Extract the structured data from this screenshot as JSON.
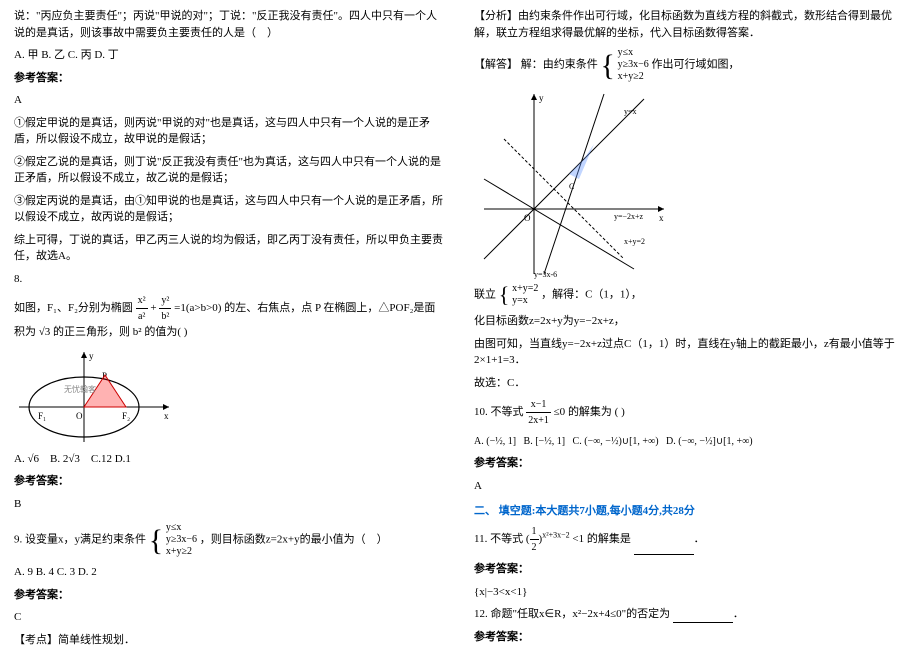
{
  "left": {
    "intro": "说：\"丙应负主要责任\"；丙说\"甲说的对\"；丁说：\"反正我没有责任\"。四人中只有一个人说的是真话，则该事故中需要负主要责任的人是（　）",
    "opts": "A. 甲   B. 乙   C. 丙   D. 丁",
    "ans_label": "参考答案：",
    "ans": "A",
    "p1": "①假定甲说的是真话，则丙说\"甲说的对\"也是真话，这与四人中只有一个人说的是正矛盾，所以假设不成立，故甲说的是假话；",
    "p2": "②假定乙说的是真话，则丁说\"反正我没有责任\"也为真话，这与四人中只有一个人说的是正矛盾，所以假设不成立，故乙说的是假话；",
    "p3": "③假定丙说的是真话，由①知甲说的也是真话，这与四人中只有一个人说的是正矛盾，所以假设不成立，故丙说的是假话；",
    "p4": "综上可得，丁说的真话，甲乙丙三人说的均为假话，即乙丙丁没有责任，所以甲负主要责任，故选A。",
    "q8_num": "8.",
    "q8a": "如图，F₁、F₂分别为椭圆",
    "q8b": "的左、右焦点，点 P 在椭圆上，△POF₂是面积为",
    "q8c": "的正三角形，则 b² 的值为(   )",
    "q8_opts_a": "A.",
    "q8_opts_b": "B.",
    "q8_opts_c": "C.12    D.1",
    "q8_ans": "B",
    "q9_num": "9. ",
    "q9a": "设变量x，y满足约束条件",
    "q9b": "，则目标函数z=2x+y的最小值为（　）",
    "q9_opts": "A. 9    B. 4    C. 3    D. 2",
    "q9_ans": "C",
    "kd_label": "【考点】",
    "kd": "简单线性规划．",
    "sys1": {
      "a": "y≤x",
      "b": "y≥3x−6",
      "c": "x+y≥2"
    },
    "ellipse": {
      "n1": "x²",
      "d1": "a²",
      "n2": "y²",
      "d2": "b²",
      "eq": "=1(a>b>0)"
    },
    "sqrt3": "√3",
    "sqrt6": "√6",
    "two_sqrt3": "2√3",
    "watermark": "无忧翰客"
  },
  "right": {
    "fx_label": "【分析】",
    "fx": "由约束条件作出可行域，化目标函数为直线方程的斜截式，数形结合得到最优解，联立方程组求得最优解的坐标，代入目标函数得答案．",
    "jd_label": "【解答】",
    "jd_a": "解：由约束条件",
    "jd_b": " 作出可行域如图，",
    "sys1": {
      "a": "y≤x",
      "b": "y≥3x−6",
      "c": "x+y≥2"
    },
    "sys2": {
      "a": "x+y=2",
      "b": "y=x"
    },
    "jd_c": "联立",
    "jd_d": "，解得：C（1，1），",
    "jd_e": "化目标函数z=2x+y为y=−2x+z，",
    "jd_f": "由图可知，当直线y=−2x+z过点C（1，1）时，直线在y轴上的截距最小，z有最小值等于2×1+1=3．",
    "jd_g": "故选：C．",
    "q10a": "10. 不等式",
    "q10b": "的解集为        (      )",
    "q10_frac": {
      "n": "x−1",
      "d": "2x+1",
      "op": "≤0"
    },
    "q10_opt_a_pre": "A.",
    "q10_opt_b_pre": "B.",
    "q10_opt_c_pre": "C.",
    "q10_opt_d_pre": "D.",
    "int_a": "(−½, 1]",
    "int_b": "[−½, 1]",
    "int_c": "(−∞, −½)∪[1, +∞)",
    "int_d": "(−∞, −½]∪[1, +∞)",
    "q10_ans": "A",
    "section2": "二、 填空题:本大题共7小题,每小题4分,共28分",
    "q11a": "11. 不等式",
    "q11b": "的解集是",
    "q11_exp_sup": "x²+3x−2",
    "q11_exp": "<1",
    "q11_base_paren": "(",
    "q11_base_frac": {
      "n": "1",
      "d": "2"
    },
    "q11_base_close": ")",
    "q11_ansline": "{x|−3<x<1}",
    "q12": "12. 命题\"任取x∈R，x²−2x+4≤0\"的否定为",
    "ans_label": "参考答案：",
    "graph_labels": {
      "y": "y",
      "x": "x",
      "o": "O",
      "yx": "y=x",
      "yz": "y=−2x+z",
      "xy2": "x+y=2",
      "y3x6": "y=3x-6"
    }
  }
}
